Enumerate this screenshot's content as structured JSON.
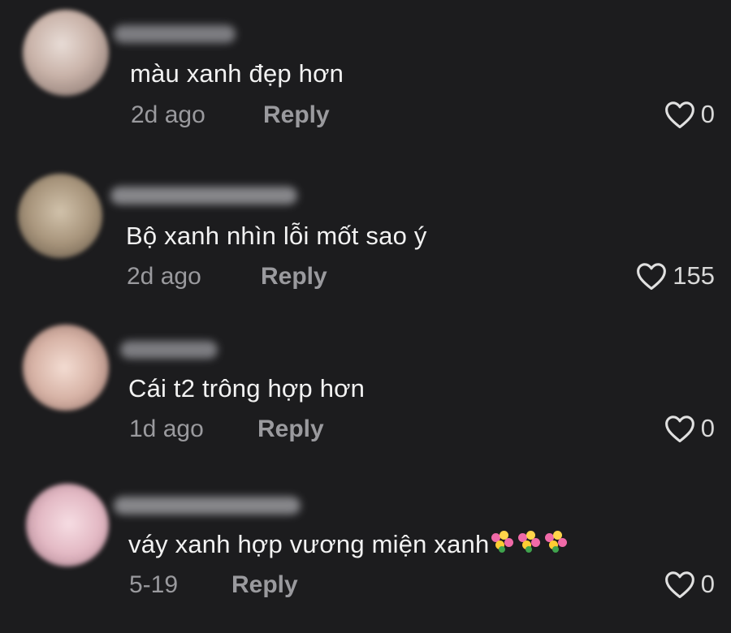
{
  "comments": [
    {
      "text": "màu xanh đẹp hơn",
      "time": "2d ago",
      "reply_label": "Reply",
      "likes": "0"
    },
    {
      "text": "Bộ xanh nhìn lỗi mốt sao ý",
      "time": "2d ago",
      "reply_label": "Reply",
      "likes": "155"
    },
    {
      "text": "Cái t2 trông hợp hơn",
      "time": "1d ago",
      "reply_label": "Reply",
      "likes": "0"
    },
    {
      "text": "váy xanh hợp vương miện xanh",
      "emoji": [
        "bouquet-icon",
        "bouquet-icon",
        "bouquet-icon"
      ],
      "time": "5-19",
      "reply_label": "Reply",
      "likes": "0"
    }
  ],
  "colors": {
    "background": "#1c1c1e",
    "text": "#f2f2f2",
    "meta": "#9a9a9e",
    "heart_outline": "#e0e0e0"
  }
}
